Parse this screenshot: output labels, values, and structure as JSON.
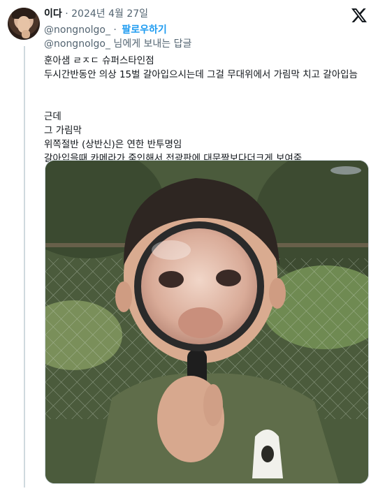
{
  "tweet": {
    "display_name": "이다",
    "separator": " · ",
    "date": "2024년 4월 27일",
    "handle": "@nongnolgo_",
    "handle_sep": " · ",
    "follow_label": "팔로우하기",
    "reply_to_handle": "@nongnolgo_",
    "reply_to_suffix": " 님에게 보내는 답글",
    "lines": [
      "훈아샘 ㄹㅈㄷ 슈퍼스타인점",
      "두시간반동안 의상 15벌 갈아입으시는데 그걸 무대위에서 가림막 치고 갈아입늠",
      "",
      "근데",
      "그 가림막",
      "위쪽절반 (상반신)은 연한 반투명임",
      "갈아입을때 카메라가 줌인해서 전광판에 대문짝보다더크게 보여줌"
    ]
  },
  "icons": {
    "platform": "x-logo-icon"
  }
}
